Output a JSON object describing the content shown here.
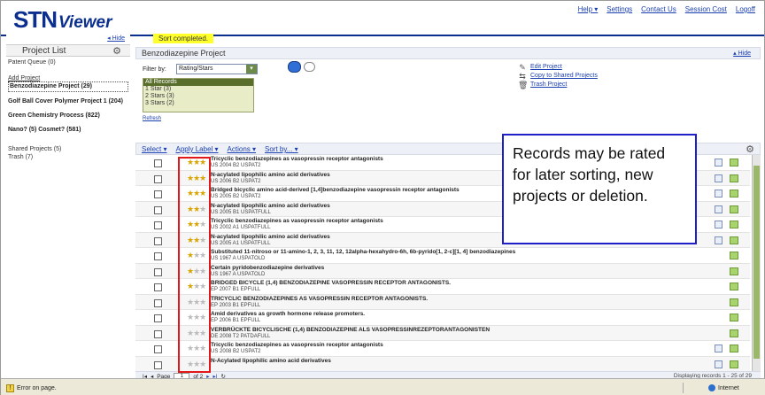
{
  "header": {
    "logo_main": "STN",
    "logo_sub": "Viewer",
    "nav": [
      "Help ▾",
      "Settings",
      "Contact Us",
      "Session Cost",
      "Logoff"
    ]
  },
  "left": {
    "hide": "◂ Hide",
    "title": "Project List",
    "patent_queue": "Patent Queue (0)",
    "add_project": "Add Project",
    "projects": [
      "Benzodiazepine Project (29)",
      "Golf Ball Cover Polymer Project 1 (204)",
      "Green Chemistry Process (822)",
      "Nano? (5) Cosmet? (581)"
    ],
    "shared": "Shared Projects (5)",
    "trash": "Trash (7)"
  },
  "main": {
    "sort_message": "Sort completed.",
    "project_title": "Benzodiazepine Project",
    "hide": "▴ Hide",
    "filter_label": "Filter by:",
    "filter_value": "Rating/Stars",
    "records_options": [
      "All Records",
      "1 Star (3)",
      "2 Stars (3)",
      "3 Stars (2)"
    ],
    "refresh": "Refresh",
    "actions": [
      "Edit Project",
      "Copy to Shared Projects",
      "Trash Project"
    ],
    "toolbar_menus": [
      "Select ▾",
      "Apply Label ▾",
      "Actions ▾",
      "Sort by... ▾"
    ],
    "records": [
      {
        "stars": 3,
        "title": "Tricyclic benzodiazepines as vasopressin receptor antagonists",
        "sub": "US 2004 B2 USPAT2",
        "icon1": true
      },
      {
        "stars": 3,
        "title": "N-acylated lipophilic amino acid derivatives",
        "sub": "US 2006 B2 USPAT2",
        "icon1": true
      },
      {
        "stars": 3,
        "title": "Bridged bicyclic amino acid-derived [1,4]benzodiazepine vasopressin receptor antagonists",
        "sub": "US 2005 B2 USPAT2",
        "icon1": true
      },
      {
        "stars": 2,
        "title": "N-acylated lipophilic amino acid derivatives",
        "sub": "US 2005 B1 USPATFULL",
        "icon1": true
      },
      {
        "stars": 2,
        "title": "Tricyclic benzodiazepines as vasopressin receptor antagonists",
        "sub": "US 2002 A1 USPATFULL",
        "icon1": true
      },
      {
        "stars": 2,
        "title": "N-acylated lipophilic amino acid derivatives",
        "sub": "US 2005 A1 USPATFULL",
        "icon1": true
      },
      {
        "stars": 1,
        "title": "Substituted 11-nitroso or 11-amino-1, 2, 3, 11, 12, 12alpha-hexahydro-6h, 6b-pyrido[1, 2-c][1, 4] benzodiazepines",
        "sub": "US 1967 A USPATOLD",
        "icon1": false
      },
      {
        "stars": 1,
        "title": "Certain pyridobenzodiazepine derivatives",
        "sub": "US 1967 A USPATOLD",
        "icon1": false
      },
      {
        "stars": 1,
        "title": "BRIDGED BICYCLE (1,4) BENZODIAZEPINE VASOPRESSIN RECEPTOR ANTAGONISTS.",
        "sub": "EP 2007 B1 EPFULL",
        "icon1": false
      },
      {
        "stars": 0,
        "title": "TRICYCLIC BENZODIAZEPINES AS VASOPRESSIN RECEPTOR ANTAGONISTS.",
        "sub": "EP 2003 B1 EPFULL",
        "icon1": false
      },
      {
        "stars": 0,
        "title": "Amid derivatives as growth hormone release promoters.",
        "sub": "EP 2006 B1 EPFULL",
        "icon1": false
      },
      {
        "stars": 0,
        "title": "VERBRÜCKTE BICYCLISCHE (1,4) BENZODIAZEPINE ALS VASOPRESSINREZEPTORANTAGONISTEN",
        "sub": "DE 2008 T2 PATDAFULL",
        "icon1": false
      },
      {
        "stars": 0,
        "title": "Tricyclic benzodiazepines as vasopressin receptor antagonists",
        "sub": "US 2008 B2 USPAT2",
        "icon1": true
      },
      {
        "stars": 0,
        "title": "N-Acylated lipophilic amino acid derivatives",
        "sub": "",
        "icon1": true
      }
    ],
    "pager_page_label": "Page",
    "pager_page": "1",
    "pager_of": "of 2",
    "pager_status": "Displaying records 1 - 25 of 29"
  },
  "callout": {
    "text": "Records may be rated for later sorting, new projects or deletion."
  },
  "statusbar": {
    "error": "Error on page.",
    "zone": "Internet"
  }
}
